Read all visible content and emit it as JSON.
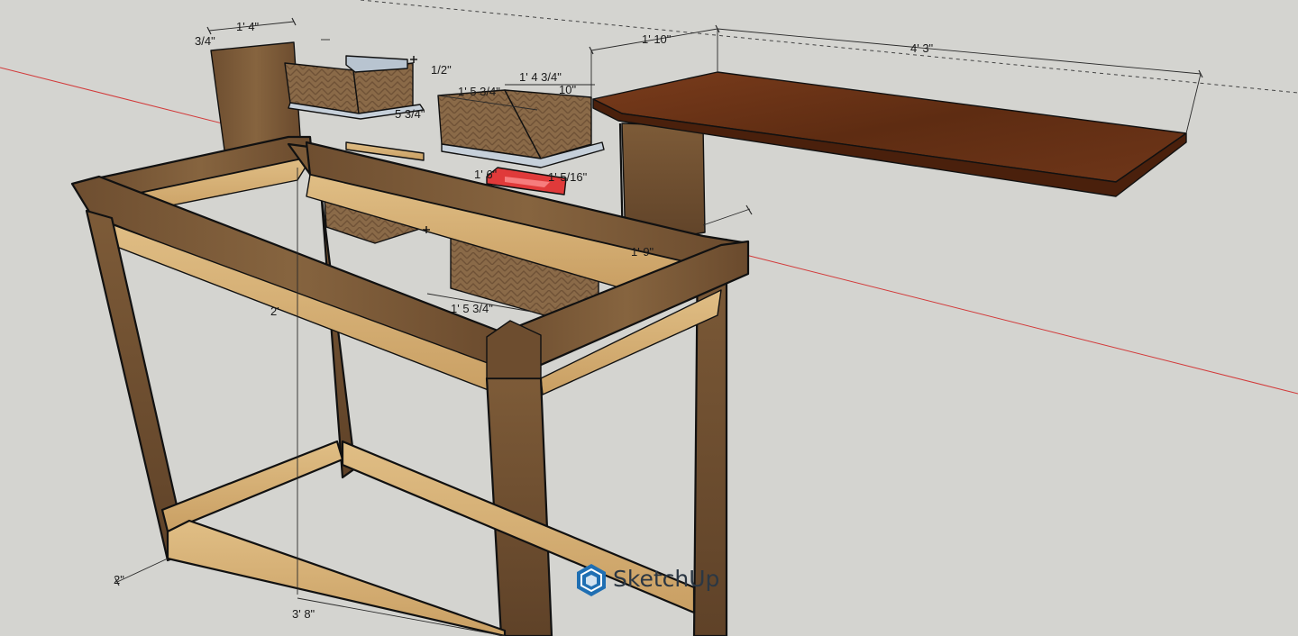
{
  "app": {
    "logo_text": "SketchUp"
  },
  "dimensions": {
    "d_3_4": "3/4\"",
    "d_1_4": "1' 4\"",
    "d_1_10": "1' 10\"",
    "d_4_3": "4' 3\"",
    "d_1_2": "1/2\"",
    "d_1_4_3_4": "1' 4 3/4\"",
    "d_1_5_3_4_top": "1' 5 3/4\"",
    "d_10": "10\"",
    "d_5_3_4": "5 3/4\"",
    "d_1_5_16": "1' 5/16\"",
    "d_1_6": "1' 6\"",
    "d_1_9": "1' 9\"",
    "d_1_5_3_4": "1' 5 3/4\"",
    "d_2_left": "2'",
    "d_2_in": "2\"",
    "d_3_8": "3' 8\""
  },
  "colors": {
    "background": "#d4d4d0",
    "walnut": "#7a5a3a",
    "pine": "#d7b37a",
    "desktop": "#6b3418",
    "axis_red": "#d23a3a",
    "red_box": "#e03a3a",
    "brand_blue": "#1f6fb3"
  },
  "icons": [
    "sketchup-logo-icon"
  ]
}
